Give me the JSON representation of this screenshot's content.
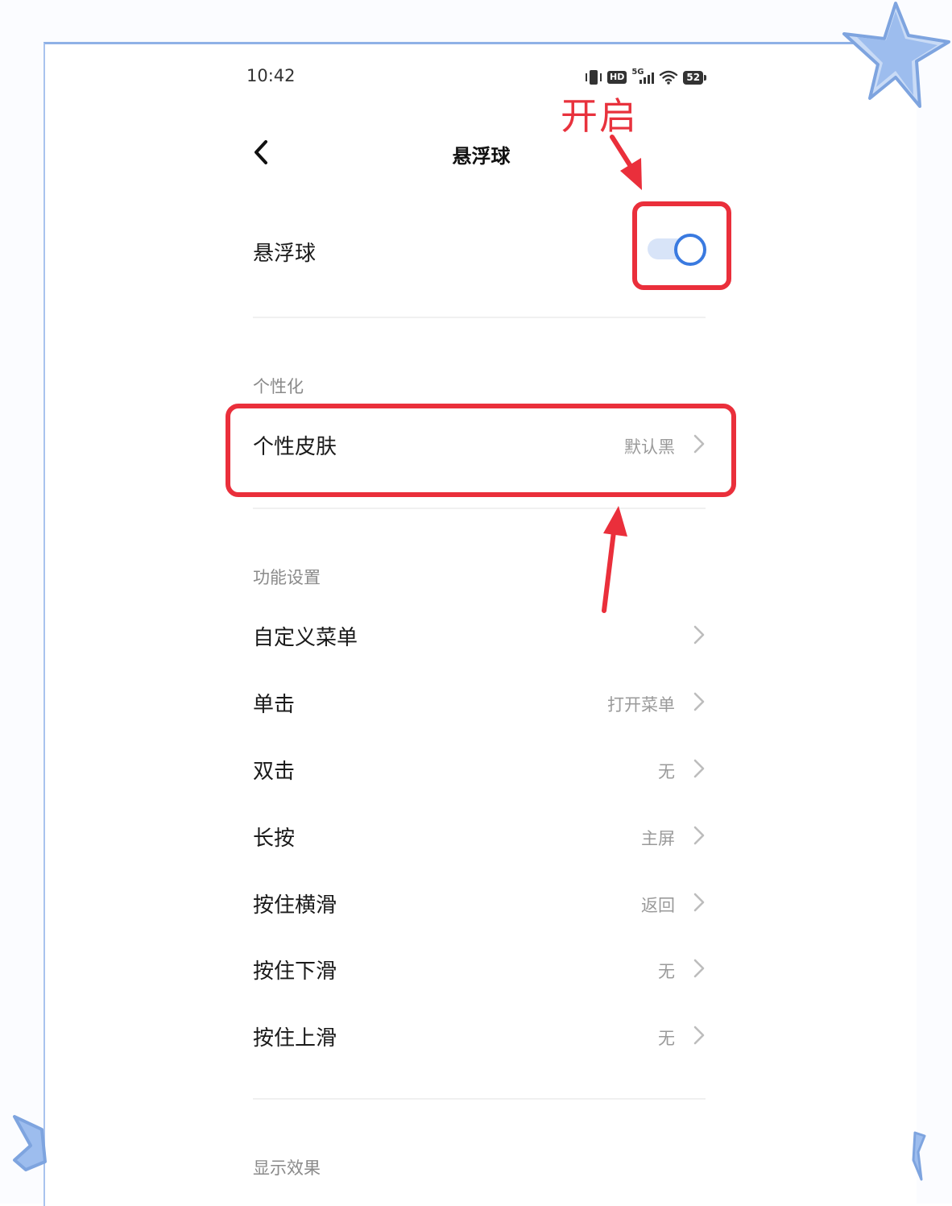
{
  "status_bar": {
    "time": "10:42",
    "hd_label": "HD",
    "network_label": "5G",
    "battery_level": "52",
    "icons": [
      "vibrate-icon",
      "hd-icon",
      "signal-5g-icon",
      "wifi-icon",
      "battery-icon"
    ]
  },
  "header": {
    "back_icon": "chevron-left-icon",
    "title": "悬浮球"
  },
  "main_toggle": {
    "label": "悬浮球",
    "enabled": true
  },
  "sections": {
    "personalization": {
      "header": "个性化",
      "skin": {
        "label": "个性皮肤",
        "value": "默认黑"
      }
    },
    "function": {
      "header": "功能设置",
      "items": [
        {
          "label": "自定义菜单",
          "value": ""
        },
        {
          "label": "单击",
          "value": "打开菜单"
        },
        {
          "label": "双击",
          "value": "无"
        },
        {
          "label": "长按",
          "value": "主屏"
        },
        {
          "label": "按住横滑",
          "value": "返回"
        },
        {
          "label": "按住下滑",
          "value": "无"
        },
        {
          "label": "按住上滑",
          "value": "无"
        }
      ]
    },
    "display": {
      "header": "显示效果"
    }
  },
  "annotation": {
    "label": "开启",
    "color": "#e8323d"
  },
  "colors": {
    "accent": "#3a7ae0",
    "toggle_track": "#d8e4f8",
    "annotation_red": "#ea2f3b",
    "frame_blue": "#8fb1e6"
  }
}
